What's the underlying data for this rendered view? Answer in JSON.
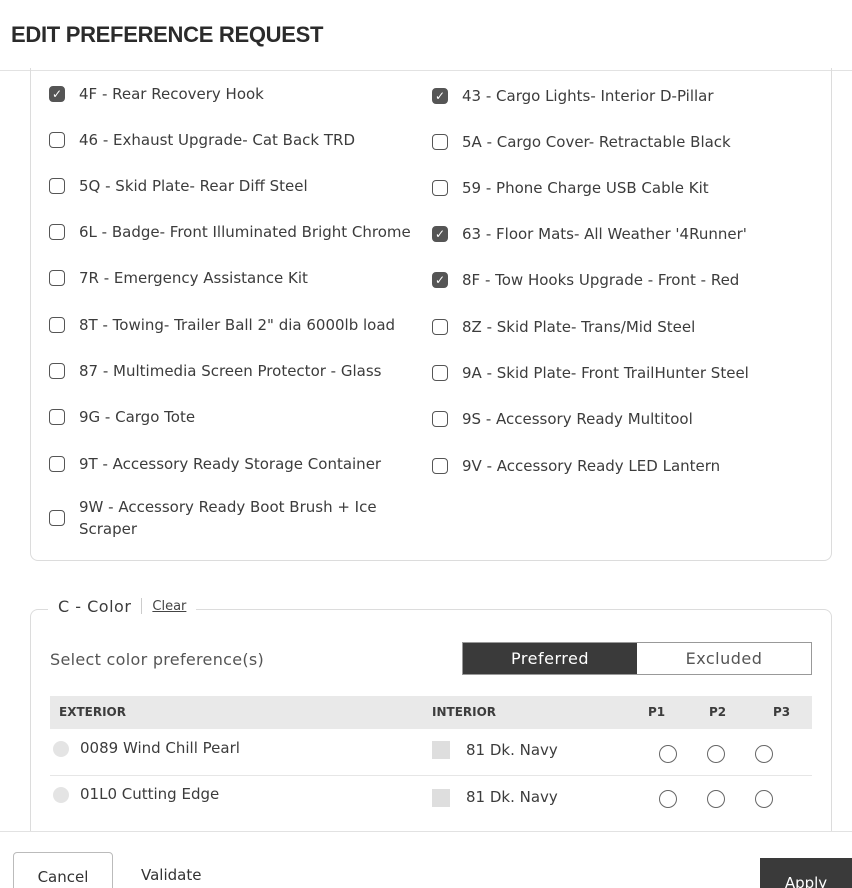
{
  "header": {
    "title": "EDIT PREFERENCE REQUEST"
  },
  "options": [
    {
      "label": "4F - Rear Recovery Hook",
      "checked": true
    },
    {
      "label": "43 - Cargo Lights- Interior D-Pillar",
      "checked": true
    },
    {
      "label": "46 - Exhaust Upgrade- Cat Back TRD",
      "checked": false
    },
    {
      "label": "5A - Cargo Cover- Retractable Black",
      "checked": false
    },
    {
      "label": "5Q - Skid Plate- Rear Diff Steel",
      "checked": false
    },
    {
      "label": "59 - Phone Charge USB Cable Kit",
      "checked": false
    },
    {
      "label": "6L - Badge- Front Illuminated Bright Chrome",
      "checked": false
    },
    {
      "label": "63 - Floor Mats- All Weather '4Runner'",
      "checked": true
    },
    {
      "label": "7R - Emergency Assistance Kit",
      "checked": false
    },
    {
      "label": "8F - Tow Hooks Upgrade - Front - Red",
      "checked": true
    },
    {
      "label": "8T - Towing- Trailer Ball 2\" dia 6000lb load",
      "checked": false
    },
    {
      "label": "8Z - Skid Plate- Trans/Mid Steel",
      "checked": false
    },
    {
      "label": "87 - Multimedia Screen Protector - Glass",
      "checked": false
    },
    {
      "label": "9A - Skid Plate- Front TrailHunter Steel",
      "checked": false
    },
    {
      "label": "9G - Cargo Tote",
      "checked": false
    },
    {
      "label": "9S - Accessory Ready Multitool",
      "checked": false
    },
    {
      "label": "9T - Accessory Ready Storage Container",
      "checked": false
    },
    {
      "label": "9V - Accessory Ready LED Lantern",
      "checked": false
    },
    {
      "label": "9W - Accessory Ready Boot Brush + Ice Scraper",
      "checked": false
    }
  ],
  "color_section": {
    "title": "C - Color",
    "clear_label": "Clear",
    "select_label": "Select color preference(s)",
    "toggle": {
      "preferred": "Preferred",
      "excluded": "Excluded",
      "active": "preferred"
    },
    "columns": {
      "exterior": "EXTERIOR",
      "interior": "INTERIOR",
      "p1": "P1",
      "p2": "P2",
      "p3": "P3"
    },
    "rows": [
      {
        "exterior": "0089 Wind Chill Pearl",
        "interior": "81 Dk. Navy"
      },
      {
        "exterior": "01L0 Cutting Edge",
        "interior": "81 Dk. Navy"
      }
    ]
  },
  "footer": {
    "cancel": "Cancel",
    "validate": "Validate",
    "apply": "Apply"
  },
  "colors": {
    "checkbox": "#555555",
    "toggle_active": "#3a3a3a",
    "apply_button": "#3a3a3a"
  }
}
